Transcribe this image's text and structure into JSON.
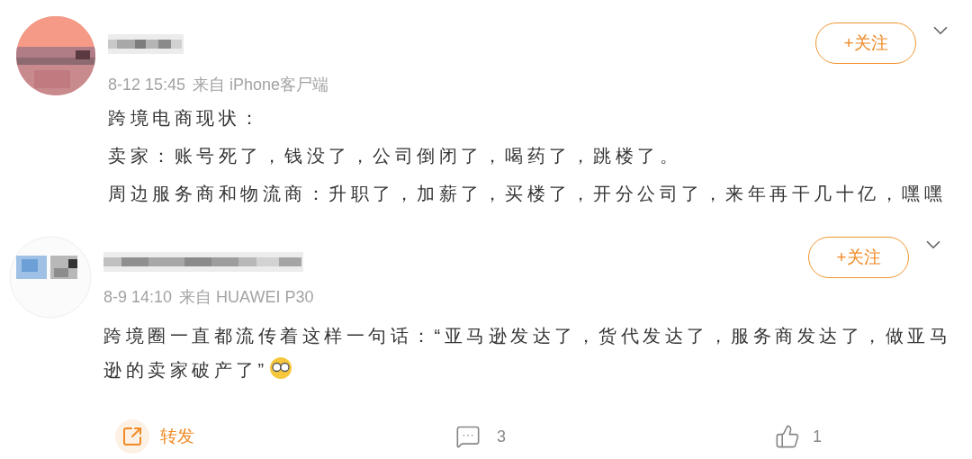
{
  "posts": [
    {
      "time": "8-12 15:45",
      "source": "来自 iPhone客尸端",
      "follow_label": "+关注",
      "body": [
        "跨境电商现状：",
        "卖家：账号死了，钱没了，公司倒闭了，喝药了，跳楼了。",
        "周边服务商和物流商：升职了，加薪了，买楼了，开分公司了，来年再干几十亿，嘿嘿"
      ],
      "emoji": false
    },
    {
      "time": "8-9 14:10",
      "source": "来自 HUAWEI P30",
      "follow_label": "+关注",
      "body": [
        "跨境圈一直都流传着这样一句话：“亚马逊发达了，货代发达了，服务商发达了，做亚马逊的卖家破产了”"
      ],
      "emoji": true
    }
  ],
  "actions": [
    {
      "kind": "repost",
      "label": "转发"
    },
    {
      "kind": "comment",
      "label": "3"
    },
    {
      "kind": "like",
      "label": "1"
    }
  ]
}
